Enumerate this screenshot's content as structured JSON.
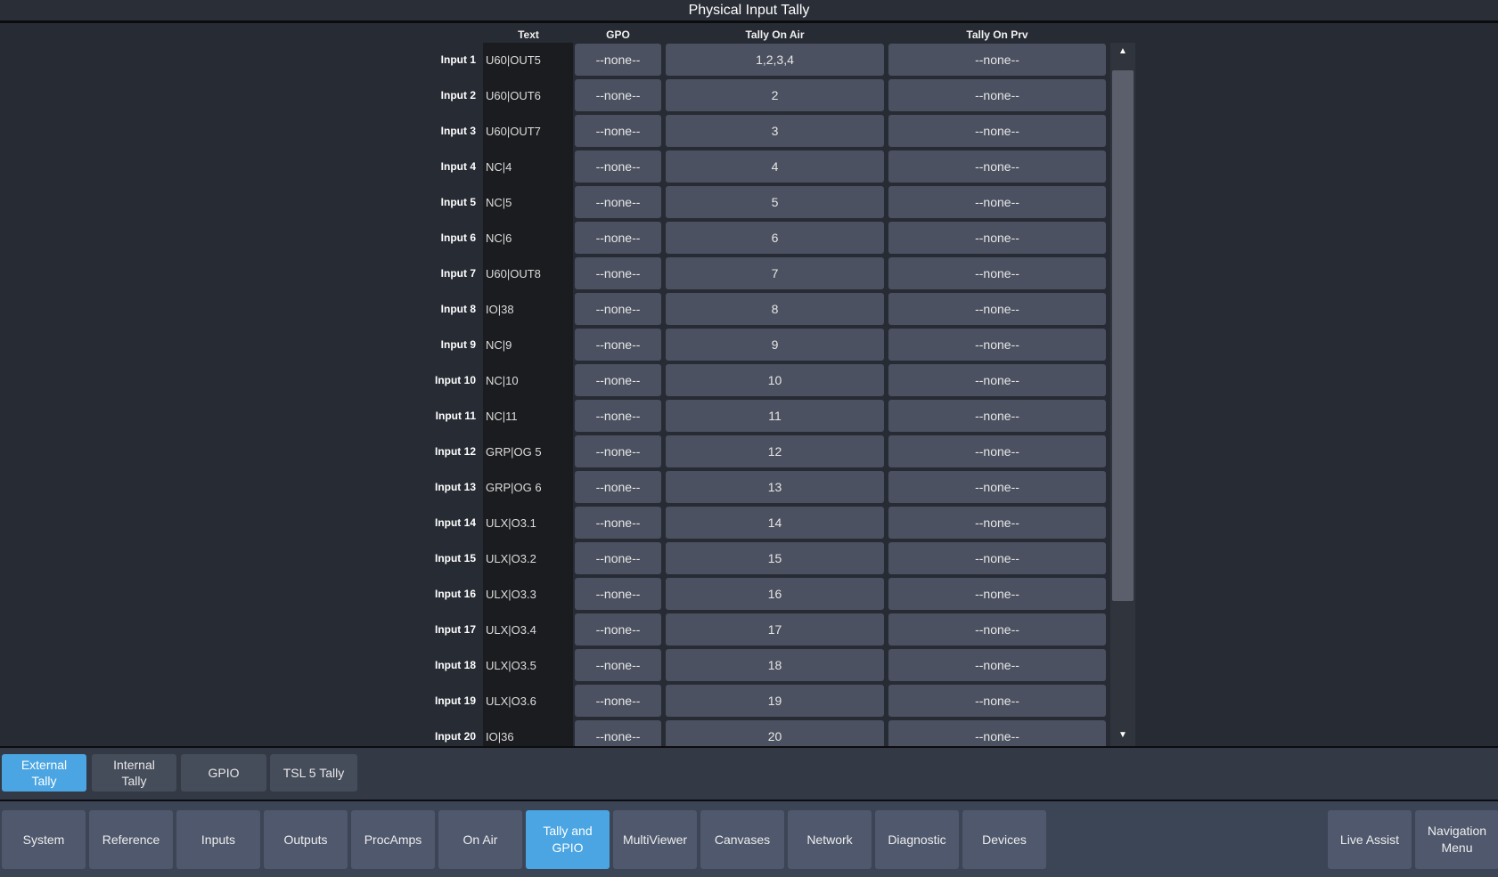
{
  "title": "Physical Input Tally",
  "columns": {
    "text": "Text",
    "gpo": "GPO",
    "air": "Tally On Air",
    "prv": "Tally On Prv"
  },
  "rows": [
    {
      "label": "Input 1",
      "text": "U60|OUT5",
      "gpo": "--none--",
      "air": "1,2,3,4",
      "prv": "--none--"
    },
    {
      "label": "Input 2",
      "text": "U60|OUT6",
      "gpo": "--none--",
      "air": "2",
      "prv": "--none--"
    },
    {
      "label": "Input 3",
      "text": "U60|OUT7",
      "gpo": "--none--",
      "air": "3",
      "prv": "--none--"
    },
    {
      "label": "Input 4",
      "text": "NC|4",
      "gpo": "--none--",
      "air": "4",
      "prv": "--none--"
    },
    {
      "label": "Input 5",
      "text": "NC|5",
      "gpo": "--none--",
      "air": "5",
      "prv": "--none--"
    },
    {
      "label": "Input 6",
      "text": "NC|6",
      "gpo": "--none--",
      "air": "6",
      "prv": "--none--"
    },
    {
      "label": "Input 7",
      "text": "U60|OUT8",
      "gpo": "--none--",
      "air": "7",
      "prv": "--none--"
    },
    {
      "label": "Input 8",
      "text": "IO|38",
      "gpo": "--none--",
      "air": "8",
      "prv": "--none--"
    },
    {
      "label": "Input 9",
      "text": "NC|9",
      "gpo": "--none--",
      "air": "9",
      "prv": "--none--"
    },
    {
      "label": "Input 10",
      "text": "NC|10",
      "gpo": "--none--",
      "air": "10",
      "prv": "--none--"
    },
    {
      "label": "Input 11",
      "text": "NC|11",
      "gpo": "--none--",
      "air": "11",
      "prv": "--none--"
    },
    {
      "label": "Input 12",
      "text": "GRP|OG 5",
      "gpo": "--none--",
      "air": "12",
      "prv": "--none--"
    },
    {
      "label": "Input 13",
      "text": "GRP|OG 6",
      "gpo": "--none--",
      "air": "13",
      "prv": "--none--"
    },
    {
      "label": "Input 14",
      "text": "ULX|O3.1",
      "gpo": "--none--",
      "air": "14",
      "prv": "--none--"
    },
    {
      "label": "Input 15",
      "text": "ULX|O3.2",
      "gpo": "--none--",
      "air": "15",
      "prv": "--none--"
    },
    {
      "label": "Input 16",
      "text": "ULX|O3.3",
      "gpo": "--none--",
      "air": "16",
      "prv": "--none--"
    },
    {
      "label": "Input 17",
      "text": "ULX|O3.4",
      "gpo": "--none--",
      "air": "17",
      "prv": "--none--"
    },
    {
      "label": "Input 18",
      "text": "ULX|O3.5",
      "gpo": "--none--",
      "air": "18",
      "prv": "--none--"
    },
    {
      "label": "Input 19",
      "text": "ULX|O3.6",
      "gpo": "--none--",
      "air": "19",
      "prv": "--none--"
    },
    {
      "label": "Input 20",
      "text": "IO|36",
      "gpo": "--none--",
      "air": "20",
      "prv": "--none--"
    }
  ],
  "sub_tabs": [
    {
      "label": "External\nTally",
      "active": true
    },
    {
      "label": "Internal\nTally"
    },
    {
      "label": "GPIO"
    },
    {
      "label": "TSL 5 Tally"
    }
  ],
  "nav": [
    {
      "label": "System"
    },
    {
      "label": "Reference"
    },
    {
      "label": "Inputs"
    },
    {
      "label": "Outputs"
    },
    {
      "label": "ProcAmps"
    },
    {
      "label": "On Air"
    },
    {
      "label": "Tally and\nGPIO",
      "active": true
    },
    {
      "label": "MultiViewer"
    },
    {
      "label": "Canvases"
    },
    {
      "label": "Network"
    },
    {
      "label": "Diagnostic"
    },
    {
      "label": "Devices"
    }
  ],
  "nav_right": [
    {
      "label": "Live Assist"
    },
    {
      "label": "Navigation\nMenu"
    }
  ],
  "colors": {
    "accent": "#4aa5e2",
    "button": "#4f586c"
  }
}
